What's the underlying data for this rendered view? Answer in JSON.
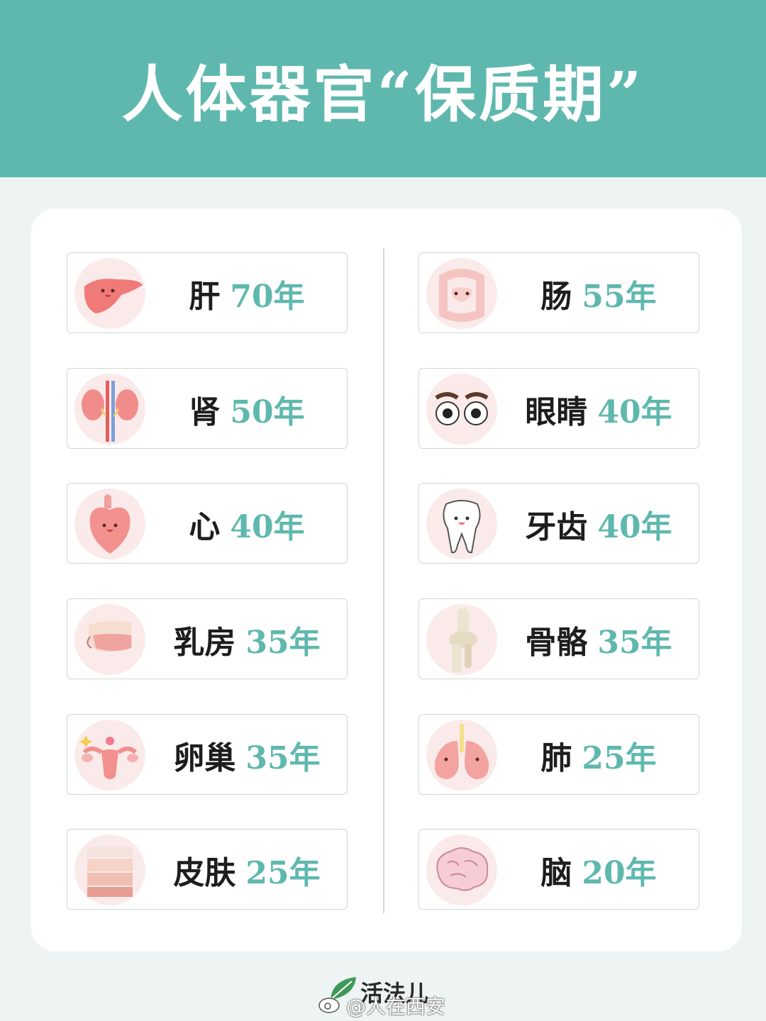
{
  "title": "人体器官“保质期”",
  "colors": {
    "accent": "#5fb8ae",
    "icon_bg": "#fbeaea"
  },
  "left_items": [
    {
      "name": "肝",
      "years": "70年",
      "icon": "liver-icon"
    },
    {
      "name": "肾",
      "years": "50年",
      "icon": "kidney-icon"
    },
    {
      "name": "心",
      "years": "40年",
      "icon": "heart-icon"
    },
    {
      "name": "乳房",
      "years": "35年",
      "icon": "breast-icon"
    },
    {
      "name": "卵巢",
      "years": "35年",
      "icon": "ovary-icon"
    },
    {
      "name": "皮肤",
      "years": "25年",
      "icon": "skin-icon"
    }
  ],
  "right_items": [
    {
      "name": "肠",
      "years": "55年",
      "icon": "intestine-icon"
    },
    {
      "name": "眼睛",
      "years": "40年",
      "icon": "eyes-icon"
    },
    {
      "name": "牙齿",
      "years": "40年",
      "icon": "tooth-icon"
    },
    {
      "name": "骨骼",
      "years": "35年",
      "icon": "bone-icon"
    },
    {
      "name": "肺",
      "years": "25年",
      "icon": "lung-icon"
    },
    {
      "name": "脑",
      "years": "20年",
      "icon": "brain-icon"
    }
  ],
  "footer": {
    "brand": "活法儿",
    "watermark": "@人在西安"
  }
}
